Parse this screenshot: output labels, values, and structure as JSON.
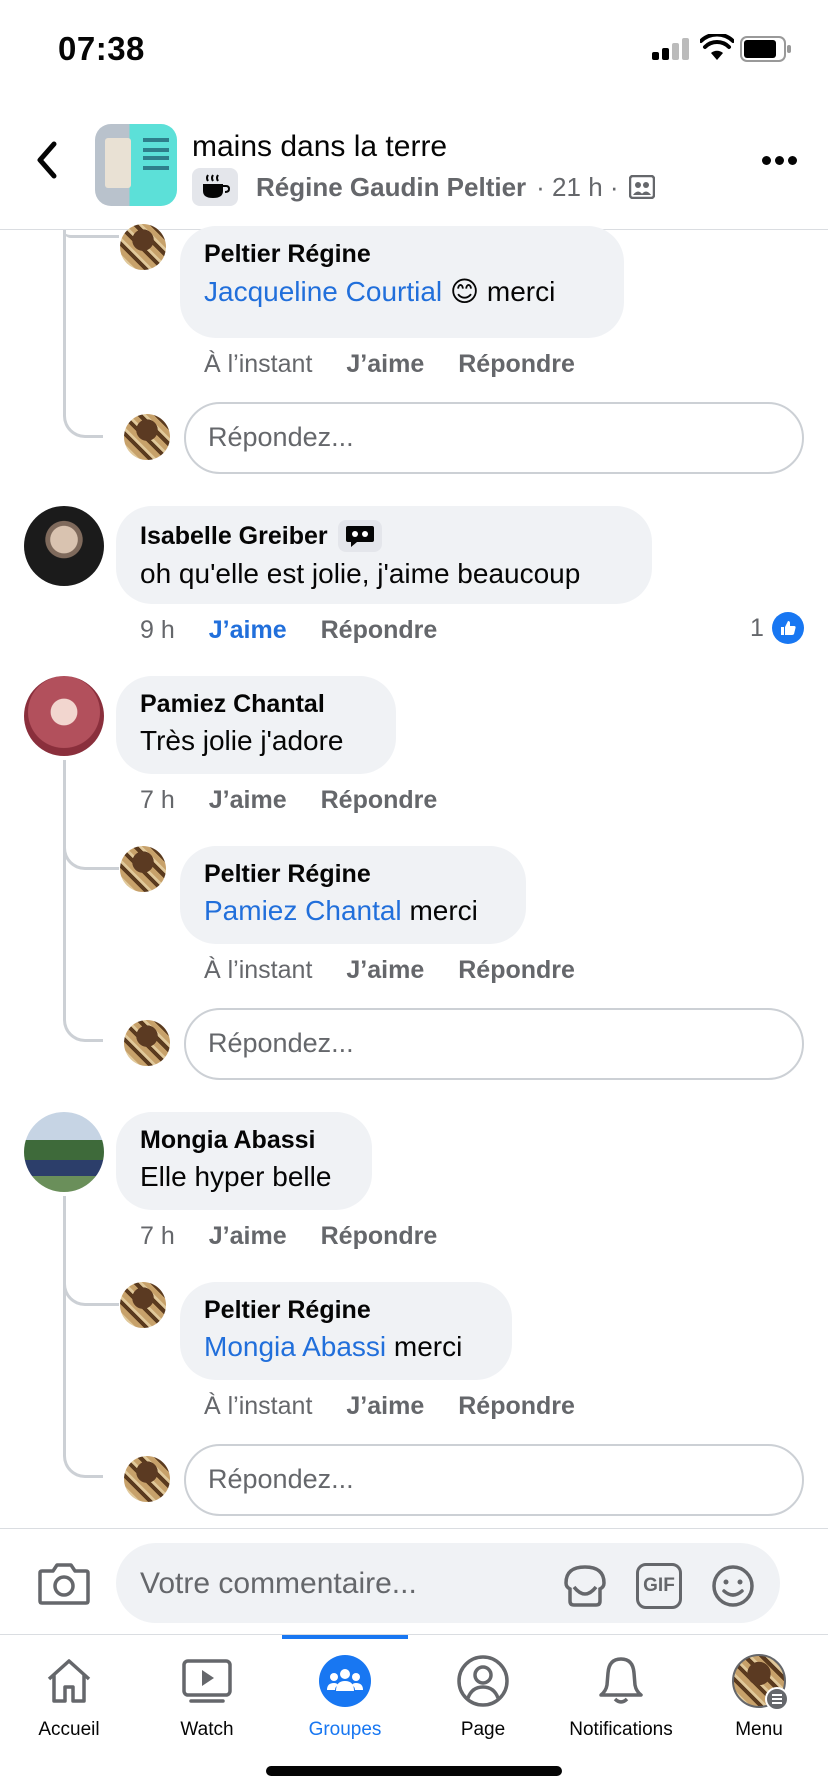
{
  "status_bar": {
    "time": "07:38"
  },
  "header": {
    "title": "mains dans la terre",
    "author": "Régine Gaudin Peltier",
    "time": "· 21 h ·",
    "back_icon": "chevron-left-icon",
    "more_icon": "ellipsis-icon"
  },
  "comments": [
    {
      "type": "reply",
      "name": "Peltier Régine",
      "mention": "Jacqueline Courtial",
      "emoji": "😊",
      "text": "merci",
      "time": "À l’instant",
      "like": "J’aime",
      "reply": "Répondre"
    },
    {
      "type": "reply_input",
      "placeholder": "Répondez..."
    },
    {
      "type": "comment",
      "name": "Isabelle Greiber",
      "text": "oh qu'elle est jolie, j'aime beaucoup",
      "time": "9 h",
      "like": "J’aime",
      "reply": "Répondre",
      "likes": "1",
      "liked": true
    },
    {
      "type": "comment",
      "name": "Pamiez Chantal",
      "text": "Très  jolie j'adore",
      "time": "7 h",
      "like": "J’aime",
      "reply": "Répondre"
    },
    {
      "type": "reply",
      "name": "Peltier Régine",
      "mention": "Pamiez Chantal",
      "text": "merci",
      "time": "À l’instant",
      "like": "J’aime",
      "reply": "Répondre"
    },
    {
      "type": "reply_input",
      "placeholder": "Répondez..."
    },
    {
      "type": "comment",
      "name": "Mongia Abassi",
      "text": "Elle hyper belle",
      "time": "7 h",
      "like": "J’aime",
      "reply": "Répondre"
    },
    {
      "type": "reply",
      "name": "Peltier Régine",
      "mention": "Mongia Abassi",
      "text": "merci",
      "time": "À l’instant",
      "like": "J’aime",
      "reply": "Répondre"
    },
    {
      "type": "reply_input",
      "placeholder": "Répondez..."
    }
  ],
  "composer": {
    "placeholder": "Votre commentaire...",
    "gif_label": "GIF"
  },
  "tabs": [
    {
      "label": "Accueil",
      "icon": "home-icon"
    },
    {
      "label": "Watch",
      "icon": "play-icon"
    },
    {
      "label": "Groupes",
      "icon": "groups-icon",
      "active": true
    },
    {
      "label": "Page",
      "icon": "profile-icon"
    },
    {
      "label": "Notifications",
      "icon": "bell-icon"
    },
    {
      "label": "Menu",
      "icon": "menu-avatar-icon"
    }
  ],
  "colors": {
    "accent": "#1877f2",
    "mention": "#216fdb",
    "bubble": "#f0f2f5",
    "muted": "#65676b"
  }
}
